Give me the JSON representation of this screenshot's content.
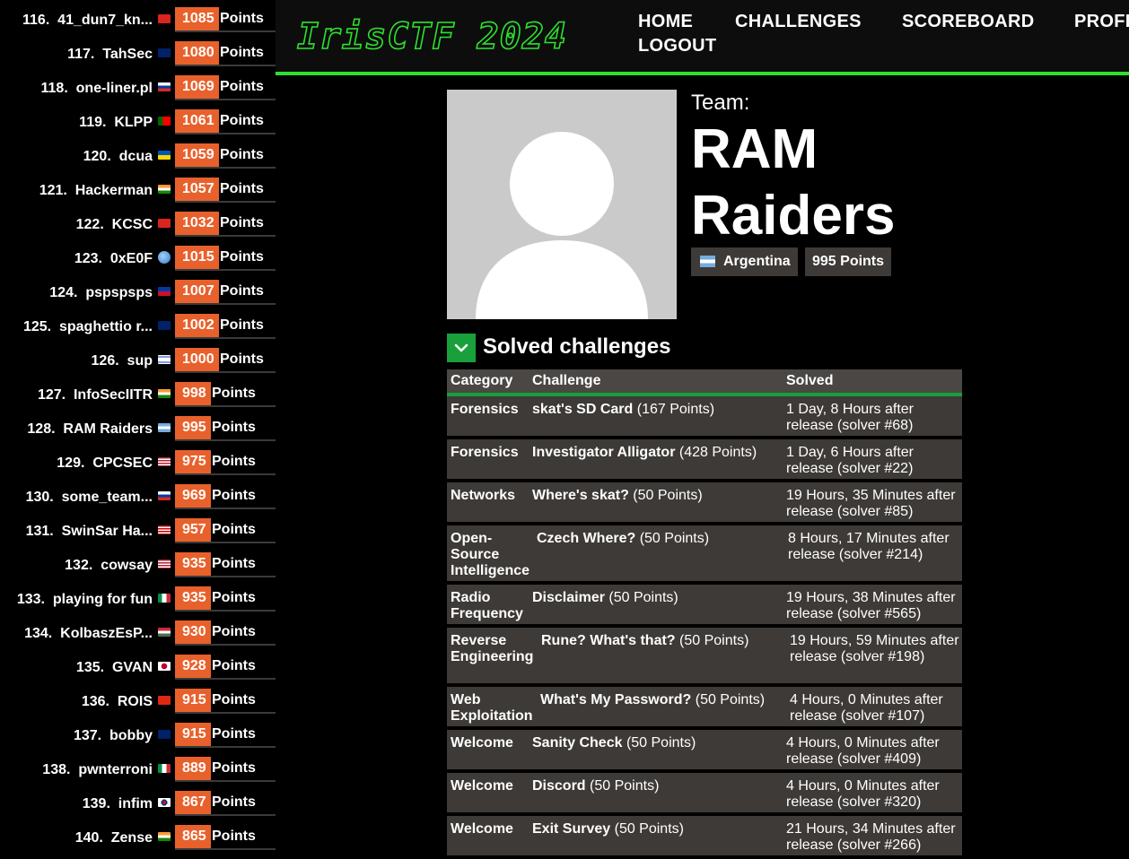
{
  "sidebar": {
    "points_label": "Points",
    "rows": [
      {
        "rank": "116.",
        "name": "41_dun7_kn...",
        "points": "1085",
        "flag": "vn"
      },
      {
        "rank": "117.",
        "name": "TahSec",
        "points": "1080",
        "flag": "au"
      },
      {
        "rank": "118.",
        "name": "one-liner.pl",
        "points": "1069",
        "flag": "ru"
      },
      {
        "rank": "119.",
        "name": "KLPP",
        "points": "1061",
        "flag": "pt"
      },
      {
        "rank": "120.",
        "name": "dcua",
        "points": "1059",
        "flag": "ua"
      },
      {
        "rank": "121.",
        "name": "Hackerman",
        "points": "1057",
        "flag": "in"
      },
      {
        "rank": "122.",
        "name": "KCSC",
        "points": "1032",
        "flag": "vn"
      },
      {
        "rank": "123.",
        "name": "0xE0F",
        "points": "1015",
        "flag": "globe"
      },
      {
        "rank": "124.",
        "name": "pspspsps",
        "points": "1007",
        "flag": "ph"
      },
      {
        "rank": "125.",
        "name": "spaghettio r...",
        "points": "1002",
        "flag": "gb"
      },
      {
        "rank": "126.",
        "name": "sup",
        "points": "1000",
        "flag": "il"
      },
      {
        "rank": "127.",
        "name": "InfoSecIITR",
        "points": "998",
        "flag": "in"
      },
      {
        "rank": "128.",
        "name": "RAM Raiders",
        "points": "995",
        "flag": "ar"
      },
      {
        "rank": "129.",
        "name": "CPCSEC",
        "points": "975",
        "flag": "us"
      },
      {
        "rank": "130.",
        "name": "some_team...",
        "points": "969",
        "flag": "ru"
      },
      {
        "rank": "131.",
        "name": "SwinSar Ha...",
        "points": "957",
        "flag": "my"
      },
      {
        "rank": "132.",
        "name": "cowsay",
        "points": "935",
        "flag": "us"
      },
      {
        "rank": "133.",
        "name": "playing for fun",
        "points": "935",
        "flag": "it"
      },
      {
        "rank": "134.",
        "name": "KolbaszEsP...",
        "points": "930",
        "flag": "hu"
      },
      {
        "rank": "135.",
        "name": "GVAN",
        "points": "928",
        "flag": "jp"
      },
      {
        "rank": "136.",
        "name": "ROIS",
        "points": "915",
        "flag": "cn"
      },
      {
        "rank": "137.",
        "name": "bobby",
        "points": "915",
        "flag": "au"
      },
      {
        "rank": "138.",
        "name": "pwnterroni",
        "points": "889",
        "flag": "it"
      },
      {
        "rank": "139.",
        "name": "infim",
        "points": "867",
        "flag": "kr"
      },
      {
        "rank": "140.",
        "name": "Zense",
        "points": "865",
        "flag": "in"
      }
    ]
  },
  "header": {
    "logo_text": "IrisCTF 2024",
    "nav": {
      "home": "HOME",
      "challenges": "CHALLENGES",
      "scoreboard": "SCOREBOARD",
      "profile": "PROFILE",
      "logout": "LOGOUT"
    }
  },
  "team": {
    "label": "Team:",
    "name": "RAM Raiders",
    "country": "Argentina",
    "points": "995 Points"
  },
  "solved": {
    "title": "Solved challenges",
    "columns": {
      "category": "Category",
      "challenge": "Challenge",
      "solved": "Solved"
    },
    "rows": [
      {
        "category": "Forensics",
        "challenge": "skat's SD Card",
        "points": "(167 Points)",
        "solved": "1 Day, 8 Hours after release (solver #68)"
      },
      {
        "category": "Forensics",
        "challenge": "Investigator Alligator",
        "points": "(428 Points)",
        "solved": "1 Day, 6 Hours after release (solver #22)"
      },
      {
        "category": "Networks",
        "challenge": "Where's skat?",
        "points": "(50 Points)",
        "solved": "19 Hours, 35 Minutes after release (solver #85)"
      },
      {
        "category": "Open-Source Intelligence",
        "challenge": "Czech Where?",
        "points": "(50 Points)",
        "solved": "8 Hours, 17 Minutes after release (solver #214)"
      },
      {
        "category": "Radio Frequency",
        "challenge": "Disclaimer",
        "points": "(50 Points)",
        "solved": "19 Hours, 38 Minutes after release (solver #565)"
      },
      {
        "category": "Reverse Engineering",
        "challenge": "Rune? What's that?",
        "points": "(50 Points)",
        "solved": "19 Hours, 59 Minutes after release (solver #198)"
      },
      {
        "category": "Web Exploitation",
        "challenge": "What's My Password?",
        "points": "(50 Points)",
        "solved": "4 Hours, 0 Minutes after release (solver #107)"
      },
      {
        "category": "Welcome",
        "challenge": "Sanity Check",
        "points": "(50 Points)",
        "solved": "4 Hours, 0 Minutes after release (solver #409)"
      },
      {
        "category": "Welcome",
        "challenge": "Discord",
        "points": "(50 Points)",
        "solved": "4 Hours, 0 Minutes after release (solver #320)"
      },
      {
        "category": "Welcome",
        "challenge": "Exit Survey",
        "points": "(50 Points)",
        "solved": "21 Hours, 34 Minutes after release (solver #266)"
      }
    ]
  },
  "colors": {
    "accent_green": "#2ee02e",
    "points_orange": "#e8612c",
    "table_bg": "#3d3a37",
    "chevron_green": "#1aa03a"
  }
}
